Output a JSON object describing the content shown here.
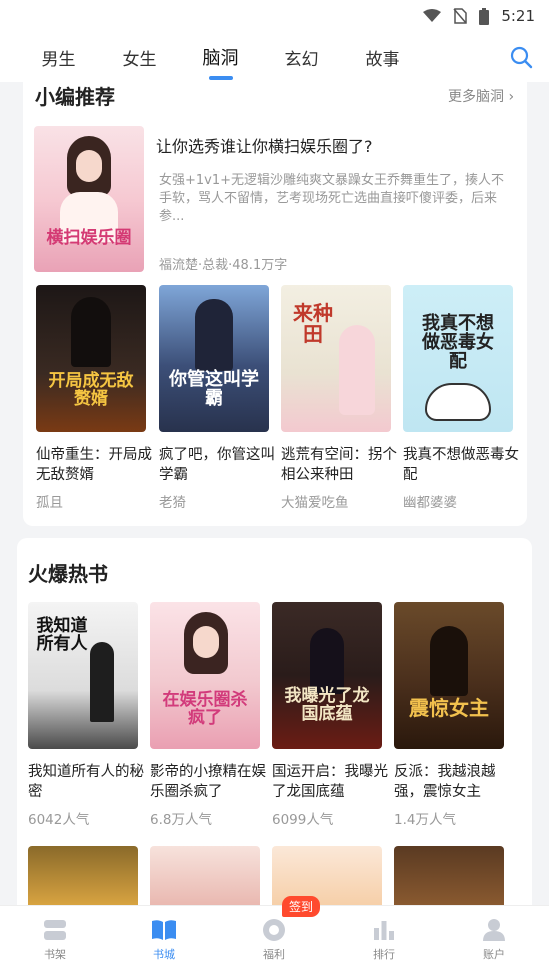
{
  "status_bar": {
    "time": "5:21"
  },
  "tabs": [
    {
      "label": "男生"
    },
    {
      "label": "女生"
    },
    {
      "label": "脑洞"
    },
    {
      "label": "玄幻"
    },
    {
      "label": "故事"
    }
  ],
  "editor_pick": {
    "title": "小编推荐",
    "more": "更多脑洞",
    "featured": {
      "title": "让你选秀谁让你横扫娱乐圈了?",
      "desc": "女强+1v1+无逻辑沙雕纯爽文暴躁女王乔舞重生了，揍人不手软，骂人不留情，艺考现场死亡选曲直接吓傻评委，后来参...",
      "meta": "福流楚·总裁·48.1万字",
      "cover_text": "横扫娱乐圈"
    },
    "books": [
      {
        "title": "仙帝重生：开局成无敌赘婿",
        "author": "孤且",
        "cover_text": "开局成无敌赘婿",
        "color": "#3a2a22"
      },
      {
        "title": "疯了吧，你管这叫学霸",
        "author": "老猗",
        "cover_text": "你管这叫学霸",
        "color": "#3c4f78"
      },
      {
        "title": "逃荒有空间：拐个相公来种田",
        "author": "大猫爱吃鱼",
        "cover_text": "来种田",
        "color": "#e9e2d2"
      },
      {
        "title": "我真不想做恶毒女配",
        "author": "幽都婆婆",
        "cover_text": "我真不想做恶毒女配",
        "color": "#bfe6f2"
      }
    ]
  },
  "hot_books": {
    "title": "火爆热书",
    "books": [
      {
        "title": "我知道所有人的秘密",
        "meta": "6042人气",
        "cover_text": "我知道所有人",
        "color": "#e8e8e8"
      },
      {
        "title": "影帝的小撩精在娱乐圈杀疯了",
        "meta": "6.8万人气",
        "cover_text": "在娱乐圈杀疯了",
        "color": "#f2c9cf"
      },
      {
        "title": "国运开启：我曝光了龙国底蕴",
        "meta": "6099人气",
        "cover_text": "我曝光了龙国底蕴",
        "color": "#2a1c1a"
      },
      {
        "title": "反派：我越浪越强，震惊女主",
        "meta": "1.4万人气",
        "cover_text": "震惊女主",
        "color": "#4a2f1c"
      }
    ]
  },
  "bottom_nav": {
    "items": [
      {
        "label": "书架"
      },
      {
        "label": "书城"
      },
      {
        "label": "福利"
      },
      {
        "label": "排行"
      },
      {
        "label": "账户"
      }
    ],
    "badge": "签到"
  }
}
